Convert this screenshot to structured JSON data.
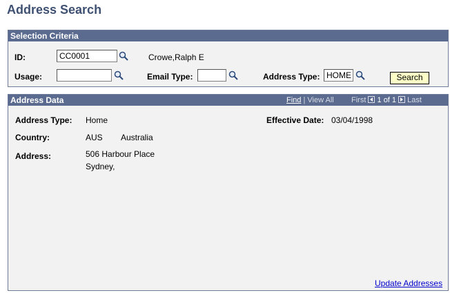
{
  "page": {
    "title": "Address Search"
  },
  "selection": {
    "header": "Selection Criteria",
    "id_label": "ID:",
    "id_value": "CC0001",
    "person_name": "Crowe,Ralph E",
    "usage_label": "Usage:",
    "usage_value": "",
    "email_type_label": "Email Type:",
    "email_type_value": "",
    "address_type_label": "Address Type:",
    "address_type_value": "HOME",
    "search_button": "Search"
  },
  "address_data": {
    "header": "Address Data",
    "nav": {
      "find": "Find",
      "sep": "|",
      "view_all": "View All",
      "first": "First",
      "count": "1 of 1",
      "last": "Last"
    },
    "address_type_label": "Address Type:",
    "address_type_value": "Home",
    "effective_date_label": "Effective Date:",
    "effective_date_value": "03/04/1998",
    "country_label": "Country:",
    "country_code": "AUS",
    "country_name": "Australia",
    "address_label": "Address:",
    "address_line1": "506 Harbour Place",
    "address_line2": "Sydney,",
    "update_link": "Update Addresses"
  },
  "icons": {
    "lookup": "magnifier-icon",
    "prev": "arrow-left-icon",
    "next": "arrow-right-icon"
  },
  "colors": {
    "title": "#3f5172",
    "header_bg": "#5a6b8f",
    "panel_bg": "#f2f2f2",
    "button_bg": "#ffffc8",
    "link": "#0000cc"
  }
}
